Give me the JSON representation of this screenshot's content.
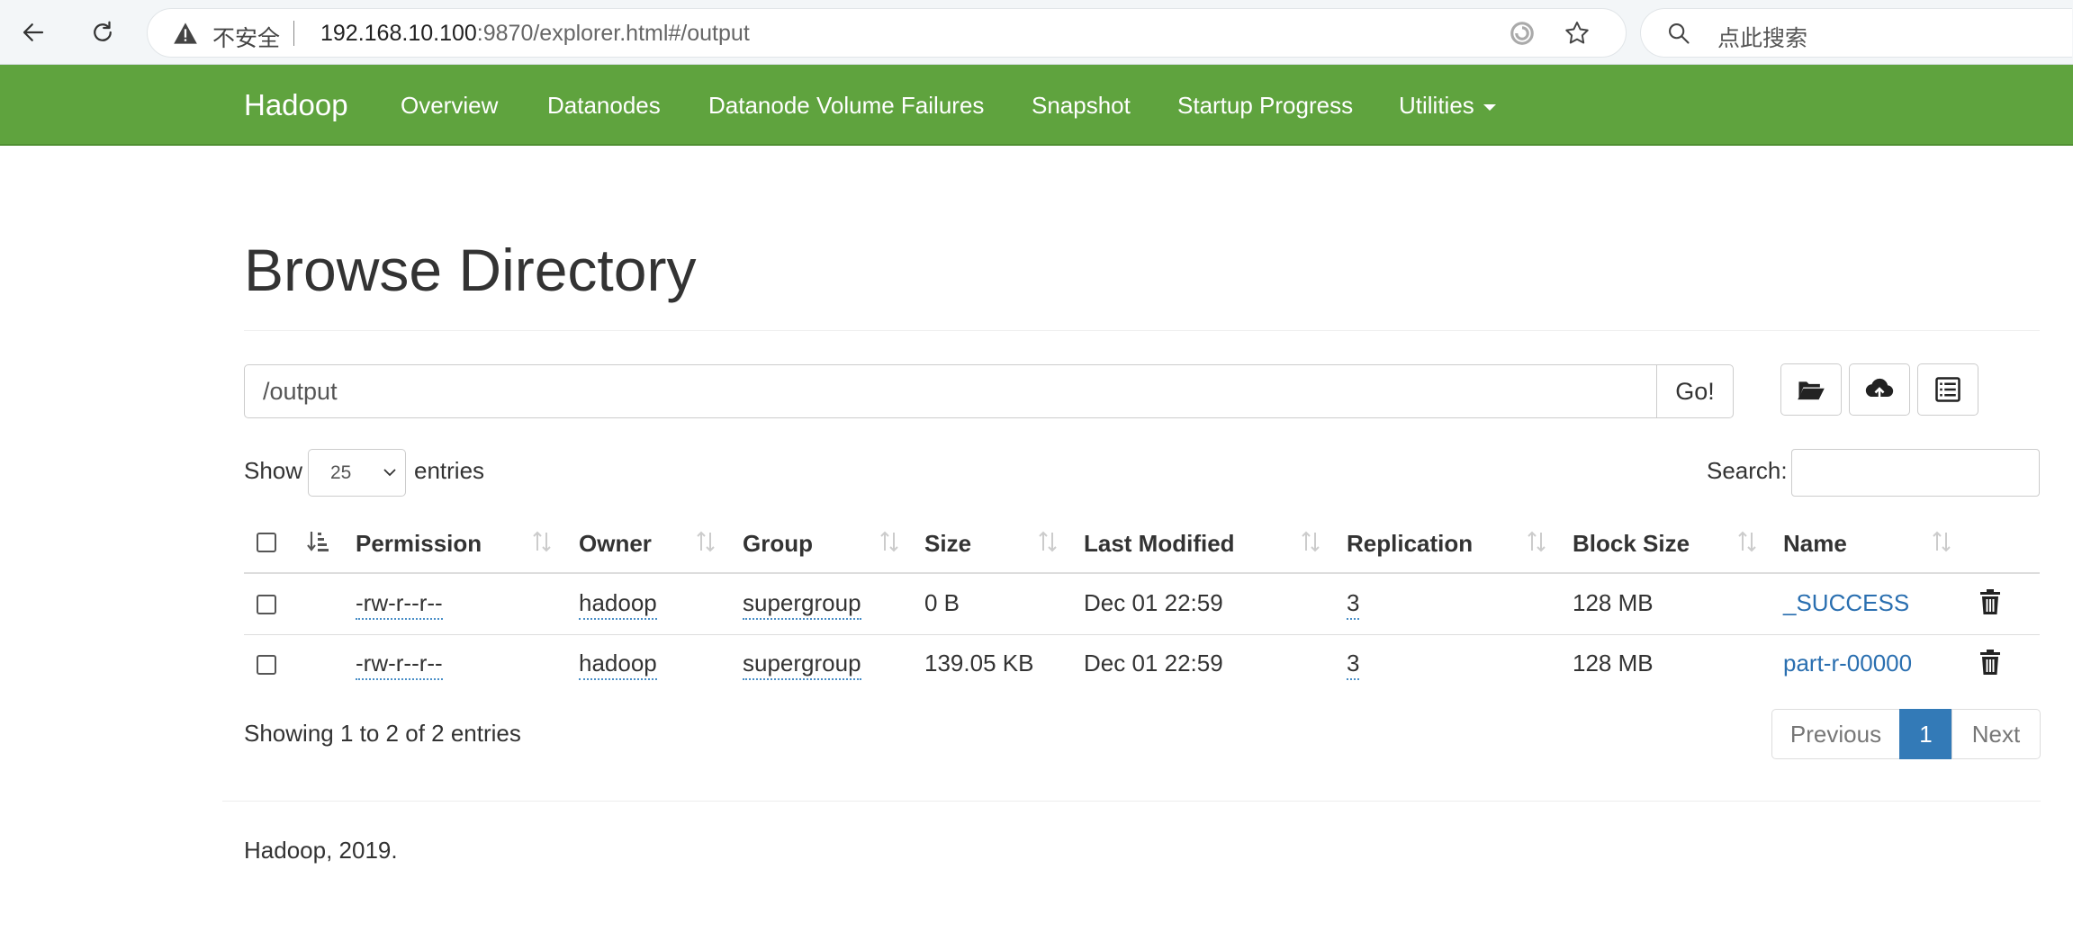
{
  "browser": {
    "security_label": "不安全",
    "url_host": "192.168.10.100",
    "url_rest": ":9870/explorer.html#/output",
    "search_placeholder": "点此搜索"
  },
  "navbar": {
    "brand": "Hadoop",
    "items": [
      "Overview",
      "Datanodes",
      "Datanode Volume Failures",
      "Snapshot",
      "Startup Progress",
      "Utilities"
    ]
  },
  "page": {
    "title": "Browse Directory",
    "path_value": "/output",
    "go_label": "Go!",
    "show_label": "Show",
    "entries_value": "25",
    "entries_label": "entries",
    "search_label": "Search:"
  },
  "table": {
    "headers": [
      "Permission",
      "Owner",
      "Group",
      "Size",
      "Last Modified",
      "Replication",
      "Block Size",
      "Name"
    ],
    "rows": [
      {
        "permission": "-rw-r--r--",
        "owner": "hadoop",
        "group": "supergroup",
        "size": "0 B",
        "modified": "Dec 01 22:59",
        "replication": "3",
        "block_size": "128 MB",
        "name": "_SUCCESS"
      },
      {
        "permission": "-rw-r--r--",
        "owner": "hadoop",
        "group": "supergroup",
        "size": "139.05 KB",
        "modified": "Dec 01 22:59",
        "replication": "3",
        "block_size": "128 MB",
        "name": "part-r-00000"
      }
    ]
  },
  "pagination": {
    "info": "Showing 1 to 2 of 2 entries",
    "previous": "Previous",
    "current": "1",
    "next": "Next"
  },
  "footer": {
    "text": "Hadoop, 2019."
  },
  "colors": {
    "navbar": "#5fa33e",
    "link": "#2a6fb0",
    "active_page": "#337ab7"
  }
}
